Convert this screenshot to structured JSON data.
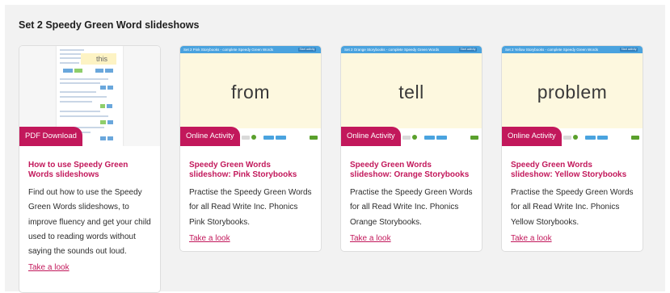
{
  "section": {
    "title": "Set 2 Speedy Green Word slideshows"
  },
  "cards": [
    {
      "badge": "PDF Download",
      "title": "How to use Speedy Green Words slideshows",
      "description": "Find out how to use the Speedy Green Words slideshows, to improve fluency and get your child used to reading words without saying the sounds out loud.",
      "link": "Take a look",
      "preview_word": "this"
    },
    {
      "badge": "Online Activity",
      "title": "Speedy Green Words slideshow: Pink Storybooks",
      "description": "Practise the Speedy Green Words for all Read Write Inc. Phonics Pink Storybooks.",
      "link": "Take a look",
      "preview_word": "from",
      "slide_header": "Set 2 Pink Storybooks - complete Speedy Green Words",
      "slide_button": "Start activity"
    },
    {
      "badge": "Online Activity",
      "title": "Speedy Green Words slideshow: Orange Storybooks",
      "description": "Practise the Speedy Green Words for all Read Write Inc. Phonics Orange Storybooks.",
      "link": "Take a look",
      "preview_word": "tell",
      "slide_header": "Set 2 Orange Storybooks - complete Speedy Green Words",
      "slide_button": "Start activity"
    },
    {
      "badge": "Online Activity",
      "title": "Speedy Green Words slideshow: Yellow Storybooks",
      "description": "Practise the Speedy Green Words for all Read Write Inc. Phonics Yellow Storybooks.",
      "link": "Take a look",
      "preview_word": "problem",
      "slide_header": "Set 2 Yellow Storybooks - complete Speedy Green Words",
      "slide_button": "Start activity"
    }
  ],
  "colors": {
    "accent": "#c2185b",
    "slide_header": "#4aa3df",
    "slide_background": "#fdf8df",
    "go_green": "#8bd14a"
  }
}
